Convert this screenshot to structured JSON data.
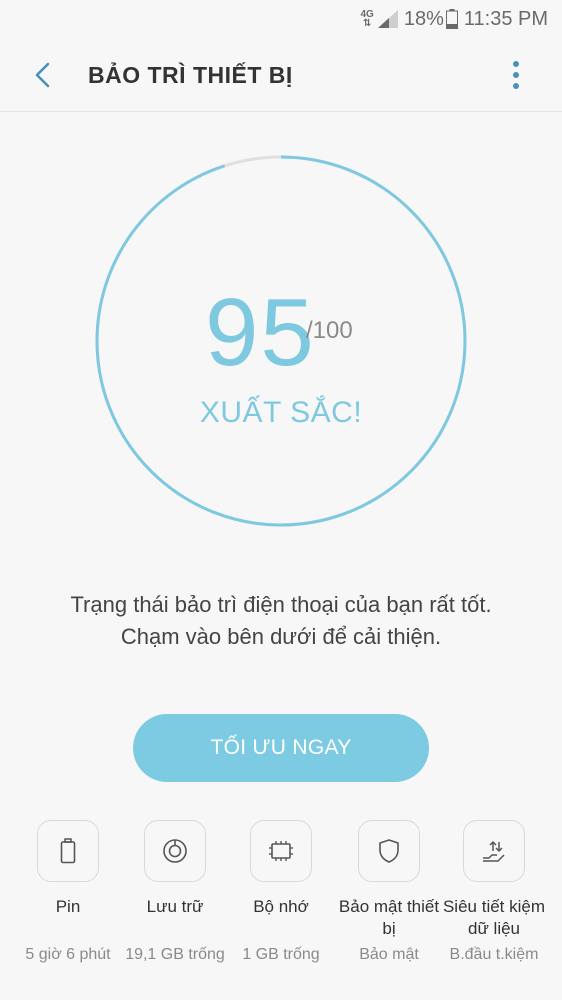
{
  "status_bar": {
    "network": "4G",
    "battery": "18%",
    "time": "11:35 PM"
  },
  "header": {
    "title": "BẢO TRÌ THIẾT BỊ"
  },
  "score": {
    "value": "95",
    "max": "/100",
    "grade": "XUẤT SẮC!",
    "fraction": 0.95
  },
  "message": {
    "line1": "Trạng thái bảo trì điện thoại của bạn rất tốt.",
    "line2": "Chạm vào bên dưới để cải thiện."
  },
  "optimize_button": {
    "label": "TỐI ƯU NGAY"
  },
  "tiles": [
    {
      "label": "Pin",
      "sub": "5 giờ 6 phút",
      "icon": "battery-icon"
    },
    {
      "label": "Lưu trữ",
      "sub": "19,1 GB trống",
      "icon": "storage-icon"
    },
    {
      "label": "Bộ nhớ",
      "sub": "1 GB trống",
      "icon": "memory-chip-icon"
    },
    {
      "label": "Bảo mật thiết bị",
      "sub": "Bảo mật",
      "icon": "shield-icon"
    },
    {
      "label": "Siêu tiết kiệm dữ liệu",
      "sub": "B.đầu t.kiệm",
      "icon": "data-saver-icon"
    }
  ],
  "colors": {
    "accent": "#7ec9e0",
    "button": "#7ccbe2",
    "track": "#e0e0e0",
    "back_icon": "#4a90b8"
  }
}
